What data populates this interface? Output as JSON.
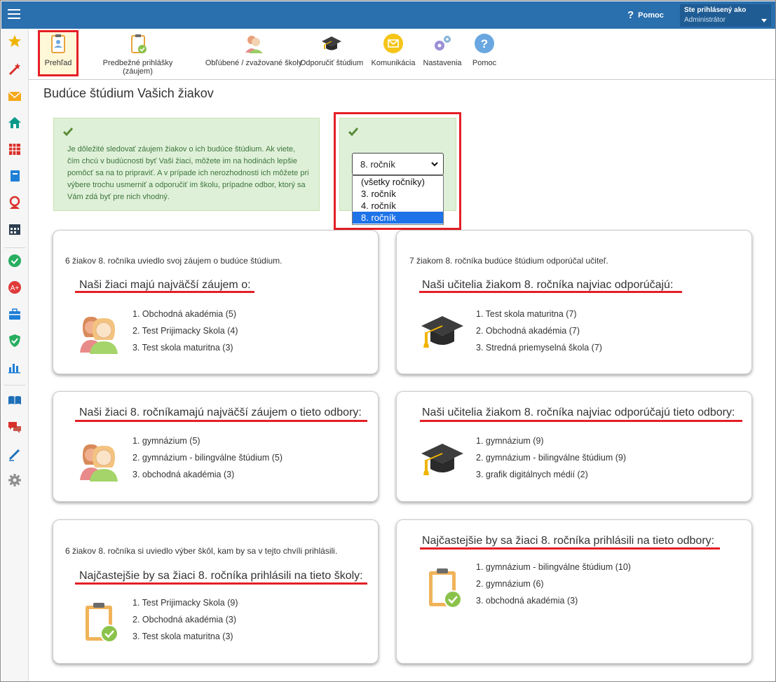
{
  "topbar": {
    "help_label": "Pomoc",
    "user_label": "Ste prihlásený ako",
    "user_role": "Administrátor"
  },
  "sidebar": {
    "icons": [
      "star-icon",
      "magic-wand-icon",
      "envelope-icon",
      "home-icon",
      "calendar-grid-icon",
      "notebook-icon",
      "person-icon",
      "schedule-icon",
      "check-circle-icon",
      "grade-icon",
      "briefcase-icon",
      "shield-check-icon",
      "bar-chart-icon",
      "book-icon",
      "chat-icon",
      "pen-icon",
      "gear-icon"
    ]
  },
  "toolbar": {
    "items": [
      {
        "label": "Prehľad"
      },
      {
        "label": "Predbežné prihlášky (záujem)"
      },
      {
        "label": "Obľúbené / zvažované školy"
      },
      {
        "label": "Odporučiť štúdium"
      },
      {
        "label": "Komunikácia"
      },
      {
        "label": "Nastavenia"
      },
      {
        "label": "Pomoc"
      }
    ]
  },
  "page": {
    "title": "Budúce štúdium Vašich žiakov"
  },
  "info": {
    "text": "Je dôležité sledovať záujem žiakov o ich budúce štúdium. Ak viete, čím chcú v budúcnosti byť Vaši žiaci, môžete im na hodinách lepšie pomôcť sa na to pripraviť. A v prípade ich nerozhodnosti ich môžete pri výbere trochu usmerniť a odporučiť im školu, prípadne odbor, ktorý sa Vám zdá byť pre nich vhodný."
  },
  "grade_select": {
    "value": "8. ročník",
    "options": [
      "(všetky ročníky)",
      "3. ročník",
      "4. ročník",
      "8. ročník"
    ],
    "selected_index": 3
  },
  "cards": [
    {
      "intro": "6 žiakov 8. ročníka uviedlo svoj záujem o budúce štúdium.",
      "heading": "Naši žiaci majú najväčší záujem o:",
      "items": [
        "1. Obchodná akadémia (5)",
        "2. Test Prijimacky Skola (4)",
        "3. Test skola maturitna (3)"
      ]
    },
    {
      "intro": "7 žiakom 8. ročníka budúce štúdium odporúčal učiteľ.",
      "heading": "Naši učitelia žiakom 8. ročníka najviac odporúčajú:",
      "items": [
        "1. Test skola maturitna (7)",
        "2. Obchodná akadémia (7)",
        "3. Stredná priemyselná škola (7)"
      ]
    },
    {
      "intro": "",
      "heading": "Naši žiaci 8. ročníkamajú najväčší záujem o tieto odbory:",
      "items": [
        "1. gymnázium (5)",
        "2. gymnázium - bilingválne štúdium (5)",
        "3. obchodná akadémia (3)"
      ]
    },
    {
      "intro": "",
      "heading": "Naši učitelia žiakom 8. ročníka najviac odporúčajú tieto odbory:",
      "items": [
        "1. gymnázium (9)",
        "2. gymnázium - bilingválne štúdium (9)",
        "3. grafik digitálnych médií (2)"
      ]
    },
    {
      "intro": "6 žiakov 8. ročníka si uviedlo výber škôl, kam by sa v tejto chvíli prihlásili.",
      "heading": "Najčastejšie by sa žiaci 8. ročníka prihlásili na tieto školy:",
      "items": [
        "1. Test Prijimacky Skola (9)",
        "2. Obchodná akadémia (3)",
        "3. Test skola maturitna (3)"
      ]
    },
    {
      "intro": "",
      "heading": "Najčastejšie by sa žiaci 8. ročníka prihlásili na tieto odbory:",
      "items": [
        "1. gymnázium - bilingválne štúdium (10)",
        "2. gymnázium (6)",
        "3. obchodná akadémia (3)"
      ]
    }
  ],
  "colors": {
    "topbar": "#2a6fae",
    "highlight_red": "#e41f26",
    "info_bg": "#dff0d8",
    "info_text": "#3c763d",
    "select_highlight": "#1e73e8"
  }
}
